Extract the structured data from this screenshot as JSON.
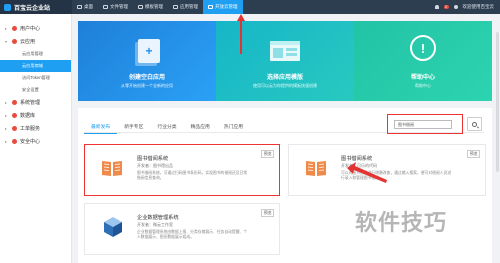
{
  "app": {
    "title": "百宝云企业站"
  },
  "topnav": [
    {
      "label": "桌面",
      "icon": "desktop-icon"
    },
    {
      "label": "文件管理",
      "icon": "folder-icon"
    },
    {
      "label": "模板管理",
      "icon": "template-icon"
    },
    {
      "label": "应用管理",
      "icon": "app-icon"
    },
    {
      "label": "开放云管理",
      "icon": "cloud-icon"
    }
  ],
  "topright": {
    "badge": "2",
    "user": "欢迎使用百宝云"
  },
  "sidebar": {
    "groups": [
      {
        "label": "用户中心",
        "expanded": false
      },
      {
        "label": "云应用",
        "expanded": true,
        "items": [
          "云应用管理",
          "云应用商城",
          "访问Token管理",
          "安全设置"
        ]
      },
      {
        "label": "系统管理",
        "expanded": false
      },
      {
        "label": "数据库",
        "expanded": false
      },
      {
        "label": "工单服务",
        "expanded": false
      },
      {
        "label": "安全中心",
        "expanded": false
      }
    ],
    "active_item": "云应用商城"
  },
  "banner": [
    {
      "title": "创建空白应用",
      "subtitle": "从零开始创建一个全新的应用"
    },
    {
      "title": "选择应用模版",
      "subtitle": "使用可以云为你提供的模板快速创建"
    },
    {
      "title": "帮助中心",
      "subtitle": "帮助中心"
    }
  ],
  "tabs": [
    "最新发布",
    "新手专区",
    "行业分类",
    "精品应用",
    "热门应用"
  ],
  "active_tab": "最新发布",
  "search": {
    "value": "图书借阅",
    "placeholder": "请输入关键字"
  },
  "cards": [
    {
      "title": "图书借阅系统",
      "developer": "开发者：图书馆出品",
      "desc": "图书借阅系统，可通过扫码图书条形码，实现图书的借阅还及日常借阅信息查询。",
      "preview": "预览",
      "icon": "book-icon"
    },
    {
      "title": "图书借阅系统",
      "developer": "开发者：可乐的代码",
      "desc": "可以对图书借阅进行增删改查，通过输入搜索，便可对借阅人员进行录入和管理图书借阅。",
      "preview": "预览",
      "icon": "book-icon"
    },
    {
      "title": "企业数据管理系统",
      "developer": "开发者：微云工作室",
      "desc": "企业数据管理系统由数据上报、分类存储展示、任务自动提醒、个人数据展示、图形数据展示组成。",
      "preview": "预览",
      "icon": "cube-icon"
    }
  ],
  "watermark": "软件技巧",
  "colors": {
    "accent": "#1e9ff2",
    "highlight": "#e33333",
    "topbar": "#2d3e50"
  }
}
